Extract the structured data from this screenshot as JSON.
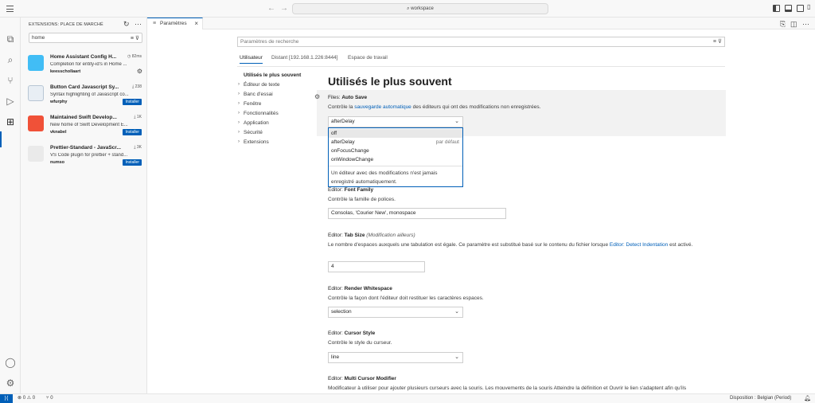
{
  "title_bar": {
    "search_label": "workspace"
  },
  "sidebar": {
    "title": "EXTENSIONS: PLACE DE MARCHÉ",
    "search_value": "home",
    "extensions": [
      {
        "name": "Home Assistant Config H...",
        "stat": "82ms",
        "desc": "Completion for entity-id's in Home ...",
        "publisher": "keesschollaart",
        "action": "gear"
      },
      {
        "name": "Button Card Javascript Sy...",
        "stat": "238",
        "desc": "Syntax highlighting of Javascript co...",
        "publisher": "wfurphy",
        "action": "Installer"
      },
      {
        "name": "Maintained Swift Develop...",
        "stat": "1K",
        "desc": "New home of Swift Development E...",
        "publisher": "vknabel",
        "action": "Installer"
      },
      {
        "name": "Prettier-Standard - JavaScr...",
        "stat": "3K",
        "desc": "VS Code plugin for prettier + stand...",
        "publisher": "numso",
        "action": "Installer"
      }
    ]
  },
  "editor": {
    "tab_label": "Paramètres",
    "search_placeholder": "Paramètres de recherche",
    "scope_tabs": [
      "Utilisateur",
      "Distant [192.168.1.226:8444]",
      "Espace de travail"
    ],
    "toc": [
      "Utilisés le plus souvent",
      "Éditeur de texte",
      "Banc d'essai",
      "Fenêtre",
      "Fonctionnalités",
      "Application",
      "Sécurité",
      "Extensions"
    ],
    "heading": "Utilisés le plus souvent",
    "settings": {
      "auto_save": {
        "category": "Files: ",
        "name": "Auto Save",
        "desc_pre": "Contrôle la ",
        "desc_link": "sauvegarde automatique",
        "desc_post": " des éditeurs qui ont des modifications non enregistrées.",
        "value": "afterDelay"
      },
      "dropdown": {
        "options": [
          "off",
          "afterDelay",
          "onFocusChange",
          "onWindowChange"
        ],
        "default_label": "par défaut",
        "selected_index": 0,
        "description": "Un éditeur avec des modifications n'est jamais enregistré automatiquement."
      },
      "font_family": {
        "category": "Editor: ",
        "name": "Font Family",
        "desc": "Contrôle la famille de polices.",
        "value": "Consolas, 'Courier New', monospace"
      },
      "tab_size": {
        "category": "Editor: ",
        "name": "Tab Size",
        "modified": "(Modification ailleurs)",
        "desc_pre": "Le nombre d'espaces auxquels une tabulation est égale. Ce paramètre est substitué basé sur le contenu du fichier lorsque ",
        "desc_link": "Editor: Detect Indentation",
        "desc_post": " est activé.",
        "value": "4"
      },
      "render_whitespace": {
        "category": "Editor: ",
        "name": "Render Whitespace",
        "desc": "Contrôle la façon dont l'éditeur doit restituer les caractères espaces.",
        "value": "selection"
      },
      "cursor_style": {
        "category": "Editor: ",
        "name": "Cursor Style",
        "desc": "Contrôle le style du curseur.",
        "value": "line"
      },
      "multi_cursor": {
        "category": "Editor: ",
        "name": "Multi Cursor Modifier",
        "desc": "Modificateur à utiliser pour ajouter plusieurs curseurs avec la souris. Les mouvements de la souris Atteindre la définition et Ouvrir le lien s'adaptent afin qu'ils"
      }
    }
  },
  "status_bar": {
    "problems": "0",
    "warnings": "0",
    "ports": "0",
    "layout": "Disposition : Belgian (Period)"
  }
}
